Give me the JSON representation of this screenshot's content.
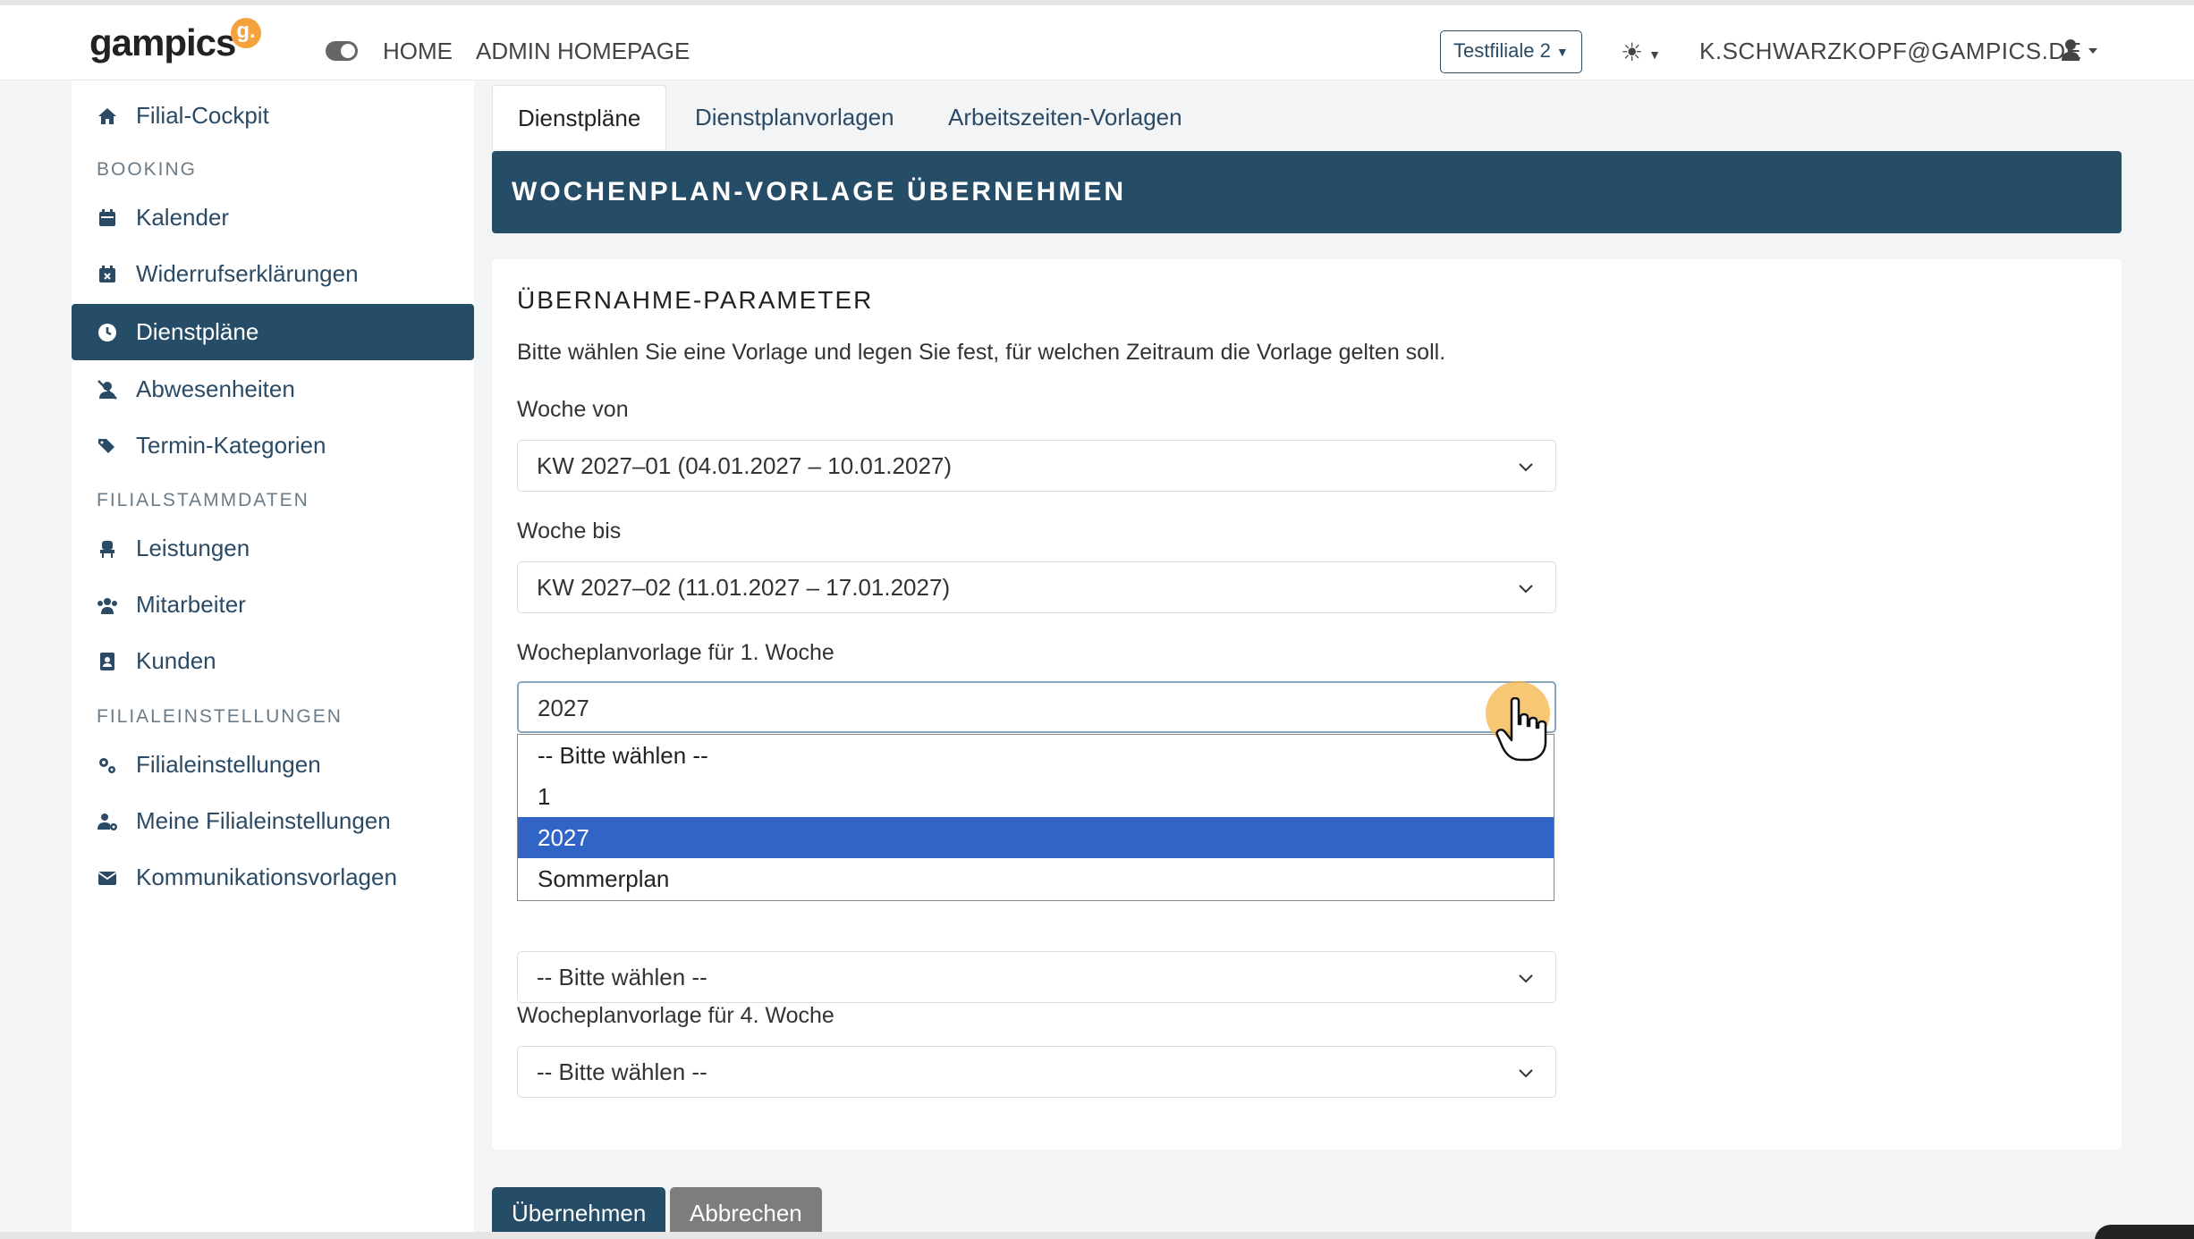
{
  "header": {
    "logo_text": "gampics",
    "logo_badge": "g.",
    "nav": [
      "HOME",
      "ADMIN HOMEPAGE"
    ],
    "branch_select": "Testfiliale 2",
    "user_email": "K.SCHWARZKOPF@GAMPICS.DE"
  },
  "sidebar": {
    "items": [
      {
        "label": "Filial-Cockpit",
        "icon": "home-icon"
      },
      {
        "label": "Kalender",
        "icon": "calendar-icon"
      },
      {
        "label": "Widerrufserklärungen",
        "icon": "calendar-x-icon"
      },
      {
        "label": "Dienstpläne",
        "icon": "clock-icon"
      },
      {
        "label": "Abwesenheiten",
        "icon": "user-slash-icon"
      },
      {
        "label": "Termin-Kategorien",
        "icon": "tags-icon"
      },
      {
        "label": "Leistungen",
        "icon": "chair-icon"
      },
      {
        "label": "Mitarbeiter",
        "icon": "users-icon"
      },
      {
        "label": "Kunden",
        "icon": "address-card-icon"
      },
      {
        "label": "Filialeinstellungen",
        "icon": "gears-icon"
      },
      {
        "label": "Meine Filialeinstellungen",
        "icon": "user-gear-icon"
      },
      {
        "label": "Kommunikationsvorlagen",
        "icon": "envelope-icon"
      }
    ],
    "headings": [
      "BOOKING",
      "FILIALSTAMMDATEN",
      "FILIALEINSTELLUNGEN"
    ]
  },
  "tabs": [
    "Dienstpläne",
    "Dienstplanvorlagen",
    "Arbeitszeiten-Vorlagen"
  ],
  "page_header": "WOCHENPLAN-VORLAGE ÜBERNEHMEN",
  "form": {
    "title": "ÜBERNAHME-PARAMETER",
    "description": "Bitte wählen Sie eine Vorlage und legen Sie fest, für welchen Zeitraum die Vorlage gelten soll.",
    "week_from_label": "Woche von",
    "week_from_value": "KW 2027–01 (04.01.2027 – 10.01.2027)",
    "week_to_label": "Woche bis",
    "week_to_value": "KW 2027–02 (11.01.2027 – 17.01.2027)",
    "week1_label": "Wocheplanvorlage für 1. Woche",
    "week1_value": "2027",
    "week3_value": "-- Bitte wählen --",
    "week4_label": "Wocheplanvorlage für 4. Woche",
    "week4_value": "-- Bitte wählen --",
    "dropdown_options": [
      "-- Bitte wählen --",
      "1",
      "2027",
      "Sommerplan"
    ],
    "submit_label": "Übernehmen",
    "cancel_label": "Abbrechen"
  },
  "colors": {
    "primary": "#264d68",
    "accent": "#f4a23b",
    "selected_option": "#3264c8"
  }
}
